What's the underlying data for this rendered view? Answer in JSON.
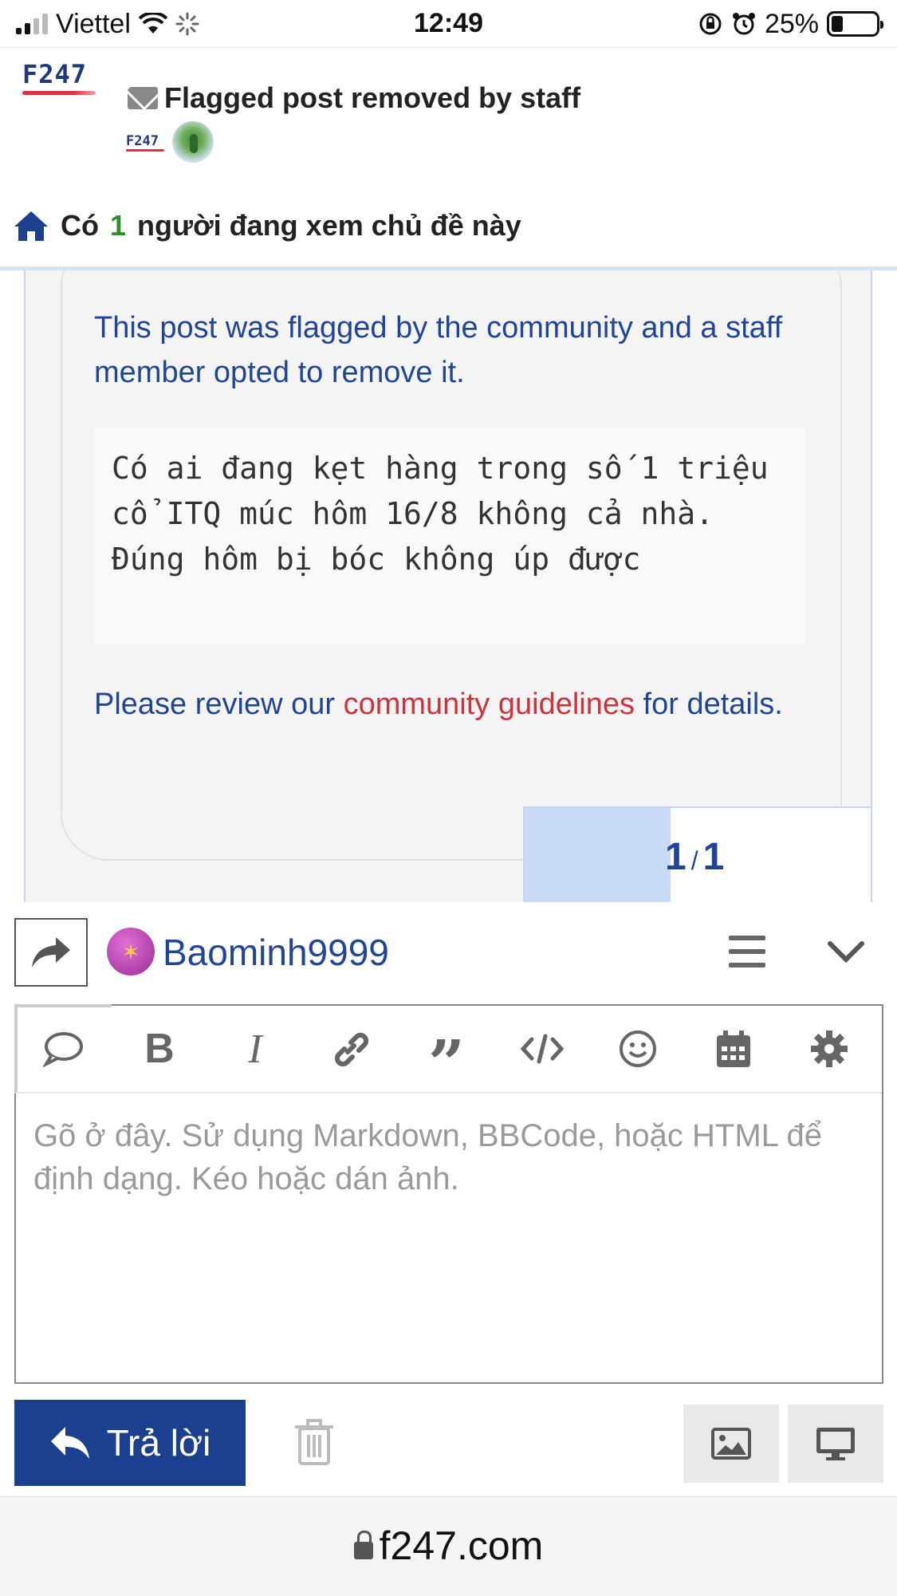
{
  "status_bar": {
    "carrier": "Viettel",
    "time": "12:49",
    "battery": "25%"
  },
  "header": {
    "logo_text": "F247",
    "topic_title": "Flagged post removed by staff",
    "participant_logo_text": "F247",
    "viewing": {
      "prefix": "Có",
      "count": "1",
      "suffix": "người đang xem chủ đề này"
    }
  },
  "post": {
    "flag_notice": "This post was flagged by the community and a staff member opted to remove it.",
    "quoted_text": "Có ai đang kẹt hàng trong số 1 triệu cổ ITQ múc hôm 16/8 không cả nhà. Đúng hôm bị bóc không úp được",
    "review_prefix": "Please review our ",
    "review_link": "community guidelines",
    "review_suffix": " for details."
  },
  "timeline": {
    "current": "1",
    "separator": "/",
    "total": "1",
    "progress_fraction": 0.42
  },
  "composer": {
    "username": "Baominh9999",
    "placeholder": "Gõ ở đây. Sử dụng Markdown, BBCode, hoặc HTML để định dạng. Kéo hoặc dán ảnh.",
    "reply_label": "Trả lời",
    "toolbar_icons": [
      "speech-bubble-icon",
      "bold-icon",
      "italic-icon",
      "link-icon",
      "quote-icon",
      "code-icon",
      "emoji-icon",
      "calendar-icon",
      "gear-icon"
    ]
  },
  "browser": {
    "url": "f247.com"
  },
  "colors": {
    "brand_blue": "#1c3f8f",
    "link_red": "#d0313a",
    "viewer_count_green": "#2f8f2f"
  }
}
